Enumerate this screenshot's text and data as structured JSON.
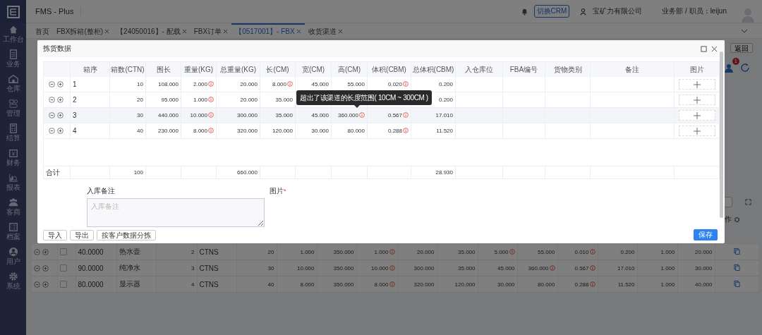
{
  "app": {
    "title": "FMS - Plus"
  },
  "sidebar": {
    "items": [
      {
        "label": "工作台"
      },
      {
        "label": "业务"
      },
      {
        "label": "仓库"
      },
      {
        "label": "管理"
      },
      {
        "label": "结算"
      },
      {
        "label": "财务"
      },
      {
        "label": "报表"
      },
      {
        "label": "客商"
      },
      {
        "label": "档案"
      },
      {
        "label": "用户"
      },
      {
        "label": "系统"
      }
    ]
  },
  "header": {
    "crm_button": "切换CRM",
    "company": "宝矿力有限公司",
    "user": "业务部 / 职员：leijun"
  },
  "tabs": [
    {
      "label": "首页",
      "selected": false,
      "closable": false
    },
    {
      "label": "FBX拆箱(整柜)",
      "selected": false,
      "closable": true
    },
    {
      "label": "【24050016】- 配载",
      "selected": false,
      "closable": true
    },
    {
      "label": "FBX订单",
      "selected": false,
      "closable": true
    },
    {
      "label": "【0517001】- FBX",
      "selected": true,
      "closable": true
    },
    {
      "label": "收货渠道",
      "selected": false,
      "closable": true
    }
  ],
  "page": {
    "back_button": "返回",
    "notification_count": "1",
    "column_fragment": "作",
    "rows": [
      {
        "checked": false,
        "cells": [
          {
            "value": "40.0000",
            "warn": false
          },
          {
            "value": "热水壶",
            "warn": false
          },
          {
            "value": "2",
            "warn": false
          },
          {
            "value": "CTNS",
            "warn": false
          },
          {
            "value": "20",
            "warn": false
          },
          {
            "value": "1.000",
            "warn": false
          },
          {
            "value": "350.000",
            "warn": false
          },
          {
            "value": "1.000",
            "warn": true
          },
          {
            "value": "20.000",
            "warn": false
          },
          {
            "value": "35.000",
            "warn": false
          },
          {
            "value": "5.000",
            "warn": true
          },
          {
            "value": "55.000",
            "warn": false
          },
          {
            "value": "0.010",
            "warn": true
          },
          {
            "value": "0.200",
            "warn": false
          },
          {
            "value": "1.000",
            "warn": false
          },
          {
            "value": "20.000",
            "warn": false
          }
        ]
      },
      {
        "checked": false,
        "cells": [
          {
            "value": "90.0000",
            "warn": false
          },
          {
            "value": "纯净水",
            "warn": false
          },
          {
            "value": "3",
            "warn": false
          },
          {
            "value": "CTNS",
            "warn": false
          },
          {
            "value": "30",
            "warn": false
          },
          {
            "value": "10.000",
            "warn": false
          },
          {
            "value": "350.000",
            "warn": false
          },
          {
            "value": "10.000",
            "warn": true
          },
          {
            "value": "300.000",
            "warn": false
          },
          {
            "value": "35.000",
            "warn": false
          },
          {
            "value": "45.000",
            "warn": false
          },
          {
            "value": "360.000",
            "warn": true
          },
          {
            "value": "0.567",
            "warn": true
          },
          {
            "value": "17.010",
            "warn": false
          },
          {
            "value": "1.000",
            "warn": false
          },
          {
            "value": "30.000",
            "warn": false
          }
        ]
      },
      {
        "checked": false,
        "cells": [
          {
            "value": "80.0000",
            "warn": false
          },
          {
            "value": "显示器",
            "warn": false
          },
          {
            "value": "4",
            "warn": false
          },
          {
            "value": "CTNS",
            "warn": false
          },
          {
            "value": "40",
            "warn": false
          },
          {
            "value": "8.000",
            "warn": false
          },
          {
            "value": "350.000",
            "warn": false
          },
          {
            "value": "8.000",
            "warn": true
          },
          {
            "value": "320.000",
            "warn": false
          },
          {
            "value": "120.000",
            "warn": false
          },
          {
            "value": "30.000",
            "warn": false
          },
          {
            "value": "80.000",
            "warn": false
          },
          {
            "value": "0.288",
            "warn": true
          },
          {
            "value": "11.520",
            "warn": false
          },
          {
            "value": "1.000",
            "warn": false
          },
          {
            "value": "40.000",
            "warn": false
          }
        ]
      }
    ]
  },
  "dialog": {
    "title": "拣货数据",
    "table": {
      "columns": [
        "箱序",
        "箱数(CTN)",
        "围长",
        "重量(KG)",
        "总重量(KG)",
        "长(CM)",
        "宽(CM)",
        "高(CM)",
        "体积(CBM)",
        "总体积(CBM)",
        "入仓库位",
        "FBA编号",
        "货物类别",
        "备注",
        "图片"
      ],
      "rows": [
        {
          "highlighted": false,
          "cells": [
            {
              "value": "1",
              "warn": false
            },
            {
              "value": "10",
              "warn": false
            },
            {
              "value": "108.000",
              "warn": false
            },
            {
              "value": "2.000",
              "warn": true
            },
            {
              "value": "20.000",
              "warn": false
            },
            {
              "value": "8.000",
              "warn": true
            },
            {
              "value": "45.000",
              "warn": false
            },
            {
              "value": "55.000",
              "warn": false
            },
            {
              "value": "0.020",
              "warn": true
            },
            {
              "value": "0.200",
              "warn": false
            }
          ]
        },
        {
          "highlighted": false,
          "cells": [
            {
              "value": "2",
              "warn": false
            },
            {
              "value": "20",
              "warn": false
            },
            {
              "value": "95.000",
              "warn": false
            },
            {
              "value": "1.000",
              "warn": true
            },
            {
              "value": "20.000",
              "warn": false
            },
            {
              "value": "35.000",
              "warn": false
            },
            null,
            null,
            null,
            {
              "value": "0.200",
              "warn": false
            }
          ]
        },
        {
          "highlighted": true,
          "cells": [
            {
              "value": "3",
              "warn": false
            },
            {
              "value": "30",
              "warn": false
            },
            {
              "value": "440.000",
              "warn": false
            },
            {
              "value": "10.000",
              "warn": true
            },
            {
              "value": "300.000",
              "warn": false
            },
            {
              "value": "35.000",
              "warn": false
            },
            {
              "value": "45.000",
              "warn": false
            },
            {
              "value": "360.000",
              "warn": true
            },
            {
              "value": "0.567",
              "warn": true
            },
            {
              "value": "17.010",
              "warn": false
            }
          ]
        },
        {
          "highlighted": false,
          "cells": [
            {
              "value": "4",
              "warn": false
            },
            {
              "value": "40",
              "warn": false
            },
            {
              "value": "230.000",
              "warn": false
            },
            {
              "value": "8.000",
              "warn": true
            },
            {
              "value": "320.000",
              "warn": false
            },
            {
              "value": "120.000",
              "warn": false
            },
            {
              "value": "30.000",
              "warn": false
            },
            {
              "value": "80.000",
              "warn": false
            },
            {
              "value": "0.288",
              "warn": true
            },
            {
              "value": "11.520",
              "warn": false
            }
          ]
        }
      ],
      "totals": {
        "label": "合计",
        "cells": [
          null,
          "100",
          null,
          null,
          "660.000",
          null,
          null,
          null,
          null,
          "28.930",
          null,
          null,
          null,
          null,
          null
        ]
      }
    },
    "tooltip": "超出了该渠道的长度范围( 10CM ~ 300CM )",
    "remark": {
      "label": "入库备注",
      "placeholder": "入库备注"
    },
    "picture": {
      "label": "图片",
      "required_mark": "*"
    },
    "buttons": [
      "导入",
      "导出",
      "按客户数据分拣"
    ],
    "save_button": "保存"
  }
}
